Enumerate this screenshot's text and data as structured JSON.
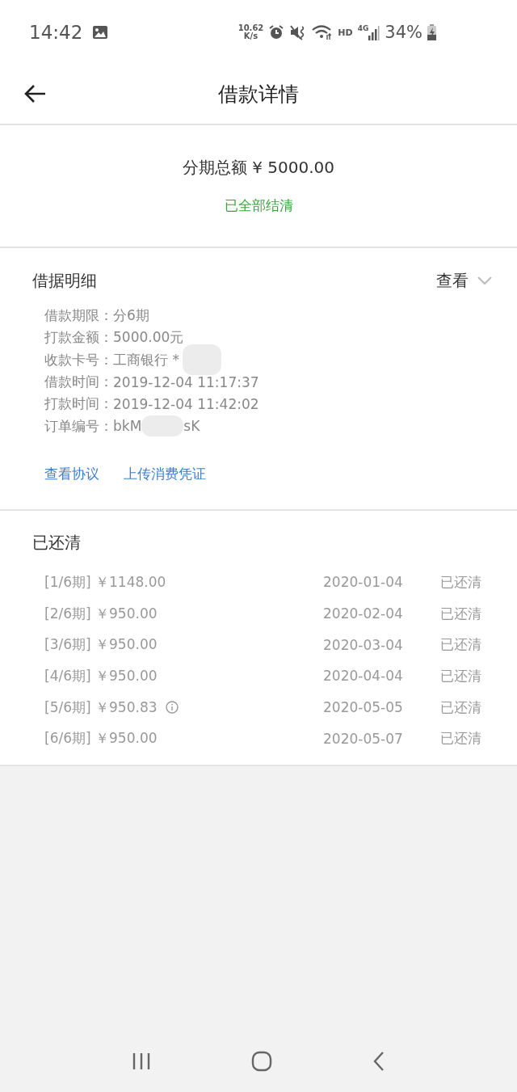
{
  "status_bar": {
    "time": "14:42",
    "speed_value": "10.62",
    "speed_unit": "K/s",
    "network_label": "HD",
    "network_type": "4G",
    "battery": "34%"
  },
  "header": {
    "title": "借款详情"
  },
  "summary": {
    "label": "分期总额 ¥ 5000.00",
    "status": "已全部结清"
  },
  "details": {
    "title": "借据明细",
    "toggle": "查看",
    "expanded": false,
    "fields": [
      {
        "label": "借款期限：",
        "value": "分6期",
        "redacted": false
      },
      {
        "label": "打款金额：",
        "value": "5000.00元",
        "redacted": false
      },
      {
        "label": "收款卡号：",
        "value": "工商银行 *",
        "redacted": true
      },
      {
        "label": "借款时间：",
        "value": "2019-12-04 11:17:37",
        "redacted": false
      },
      {
        "label": "打款时间：",
        "value": "2019-12-04 11:42:02",
        "redacted": false
      },
      {
        "label": "订单编号：",
        "value": "bkM",
        "value_end": "sK",
        "redacted": true
      }
    ],
    "links": [
      "查看协议",
      "上传消费凭证"
    ]
  },
  "repayments": {
    "title": "已还清",
    "rows": [
      {
        "term": "[1/6期]",
        "amount": "￥1148.00",
        "info": false,
        "date": "2020-01-04",
        "status": "已还清"
      },
      {
        "term": "[2/6期]",
        "amount": "￥950.00",
        "info": false,
        "date": "2020-02-04",
        "status": "已还清"
      },
      {
        "term": "[3/6期]",
        "amount": "￥950.00",
        "info": false,
        "date": "2020-03-04",
        "status": "已还清"
      },
      {
        "term": "[4/6期]",
        "amount": "￥950.00",
        "info": false,
        "date": "2020-04-04",
        "status": "已还清"
      },
      {
        "term": "[5/6期]",
        "amount": "￥950.83",
        "info": true,
        "date": "2020-05-05",
        "status": "已还清"
      },
      {
        "term": "[6/6期]",
        "amount": "￥950.00",
        "info": false,
        "date": "2020-05-07",
        "status": "已还清"
      }
    ]
  }
}
